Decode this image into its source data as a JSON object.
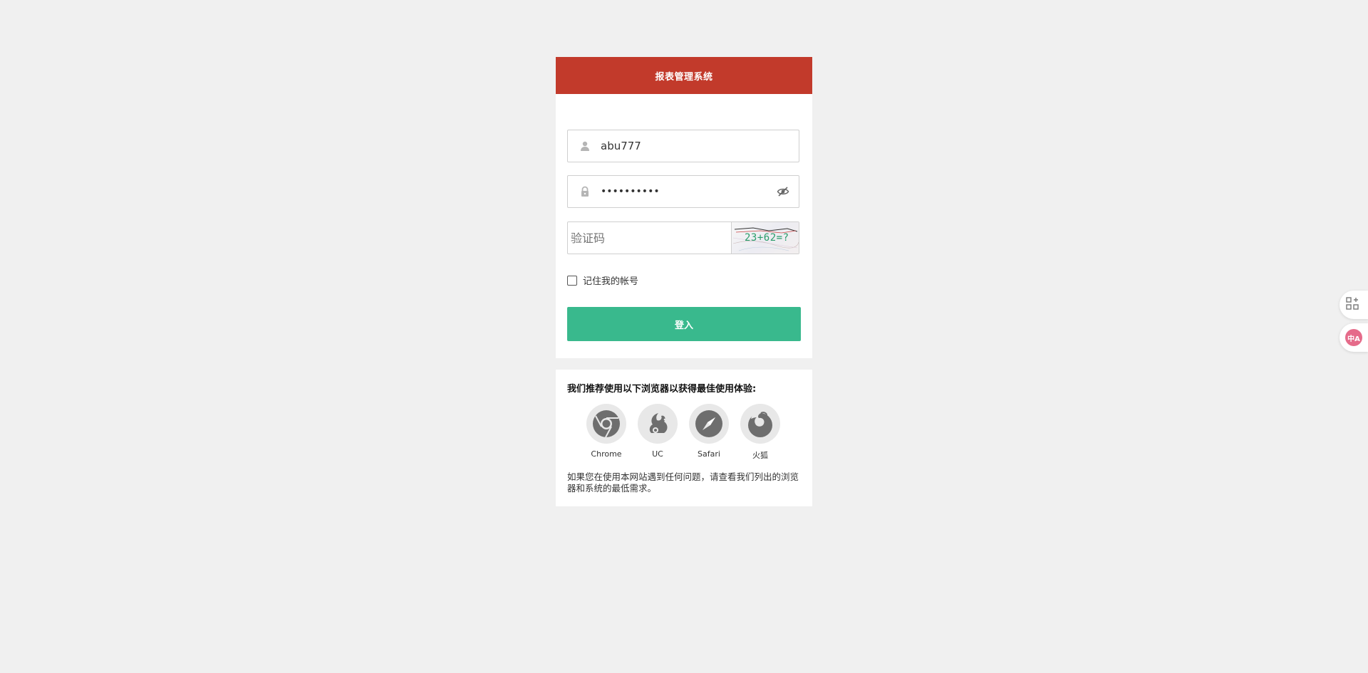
{
  "header": {
    "title": "报表管理系统"
  },
  "form": {
    "username": {
      "value": "abu777"
    },
    "password": {
      "masked": "••••••••••"
    },
    "captcha": {
      "placeholder": "验证码",
      "image_text": "23+62=?"
    },
    "remember_label": "记住我的帐号",
    "submit_label": "登入"
  },
  "browsers": {
    "title": "我们推荐使用以下浏览器以获得最佳使用体验:",
    "items": [
      {
        "label": "Chrome",
        "icon": "chrome-icon"
      },
      {
        "label": "UC",
        "icon": "uc-icon"
      },
      {
        "label": "Safari",
        "icon": "safari-icon"
      },
      {
        "label": "火狐",
        "icon": "firefox-icon"
      }
    ],
    "note": "如果您在使用本网站遇到任何问题，请查看我们列出的浏览器和系统的最低需求。"
  },
  "side_tools": {
    "translate_badge": "中A"
  },
  "colors": {
    "header_bg": "#c23a2b",
    "button_bg": "#39b98d",
    "page_bg": "#f0f0f0"
  }
}
